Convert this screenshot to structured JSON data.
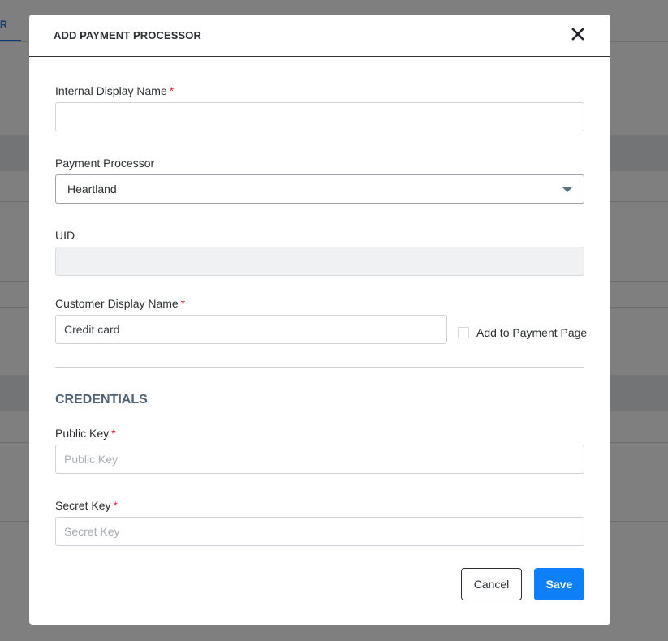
{
  "background": {
    "tab_label": "R",
    "accent_color": "#1a73e8"
  },
  "modal": {
    "title": "ADD PAYMENT PROCESSOR",
    "close_icon": "close-icon",
    "fields": {
      "internal_display_name": {
        "label": "Internal Display Name",
        "required_mark": "*",
        "value": ""
      },
      "payment_processor": {
        "label": "Payment Processor",
        "selected": "Heartland"
      },
      "uid": {
        "label": "UID",
        "value": ""
      },
      "customer_display_name": {
        "label": "Customer Display Name",
        "required_mark": "*",
        "value": "Credit card"
      },
      "add_to_payment_page": {
        "label": "Add to Payment Page",
        "checked": false
      }
    },
    "credentials": {
      "title": "CREDENTIALS",
      "public_key": {
        "label": "Public Key",
        "required_mark": "*",
        "placeholder": "Public Key",
        "value": ""
      },
      "secret_key": {
        "label": "Secret Key",
        "required_mark": "*",
        "placeholder": "Secret Key",
        "value": ""
      }
    },
    "buttons": {
      "cancel": "Cancel",
      "save": "Save",
      "save_color": "#0d7ff7"
    }
  }
}
